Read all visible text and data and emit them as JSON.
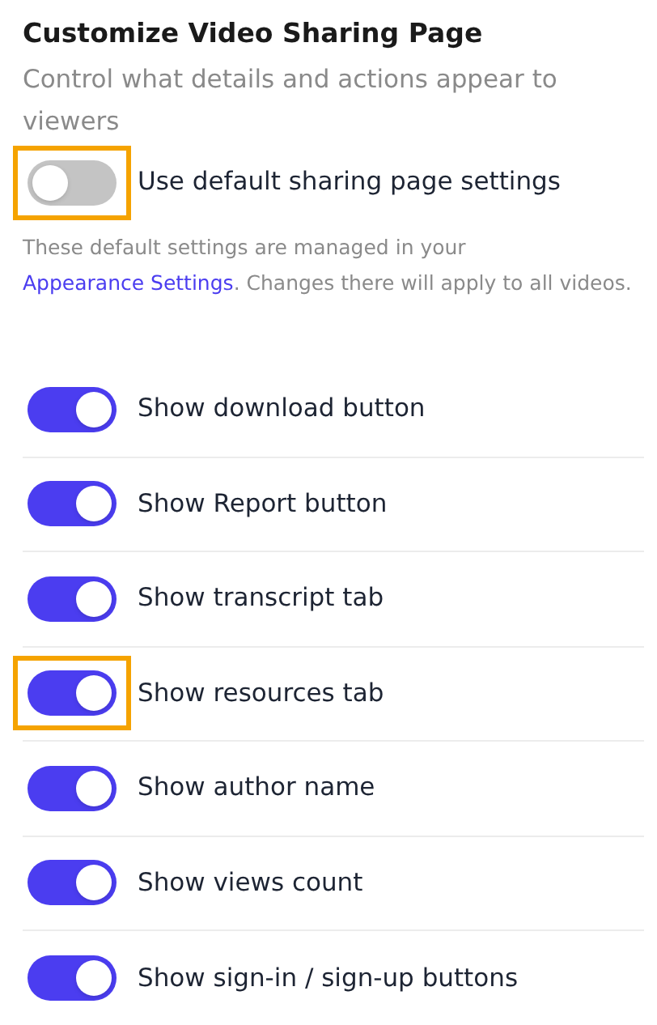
{
  "title": "Customize Video Sharing Page",
  "subtitle": "Control what details and actions appear to viewers",
  "default_toggle": {
    "label": "Use default sharing page settings",
    "on": false,
    "highlighted": true
  },
  "note": {
    "text_before": "These default settings are managed in your",
    "link": "Appearance Settings",
    "text_after": ". Changes there will apply to all videos."
  },
  "toggles": [
    {
      "label": "Show download button",
      "on": true,
      "highlighted": false
    },
    {
      "label": "Show Report button",
      "on": true,
      "highlighted": false
    },
    {
      "label": "Show transcript tab",
      "on": true,
      "highlighted": false
    },
    {
      "label": "Show resources tab",
      "on": true,
      "highlighted": true
    },
    {
      "label": "Show author name",
      "on": true,
      "highlighted": false
    },
    {
      "label": "Show views count",
      "on": true,
      "highlighted": false
    },
    {
      "label": "Show sign-in / sign-up buttons",
      "on": true,
      "highlighted": false
    }
  ]
}
